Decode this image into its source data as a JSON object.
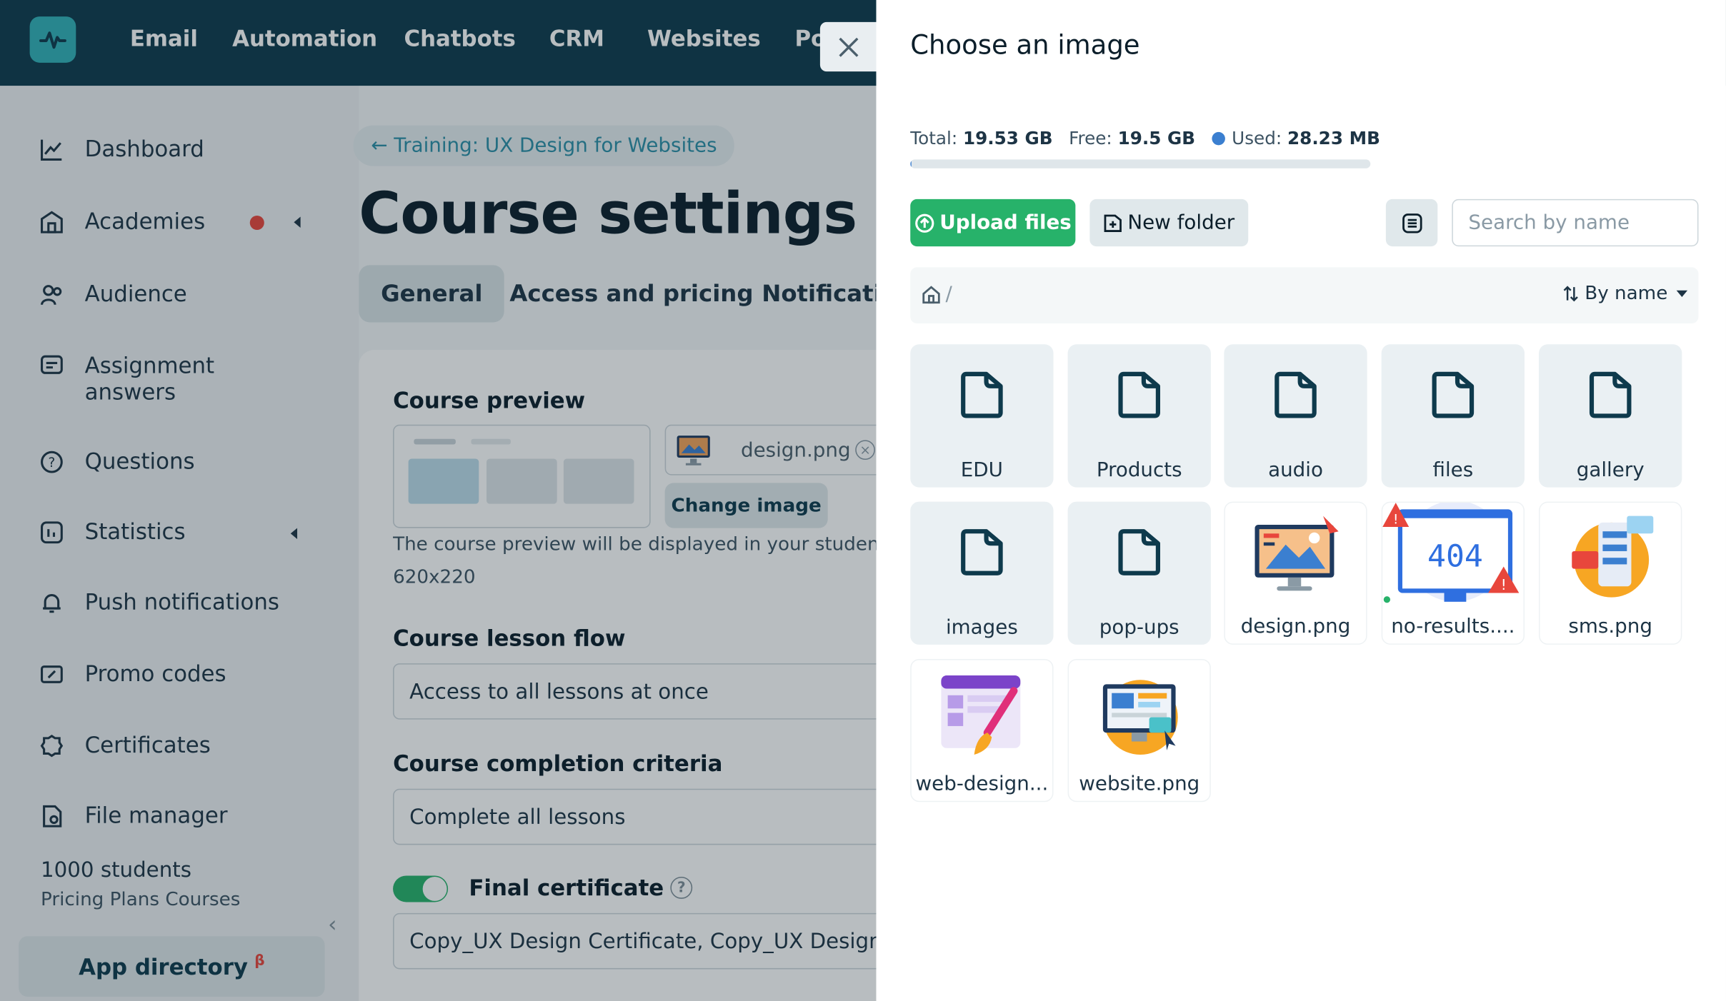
{
  "topnav": {
    "items": [
      "Email",
      "Automation",
      "Chatbots",
      "CRM",
      "Websites",
      "Po"
    ]
  },
  "sidebar": {
    "items": [
      {
        "label": "Dashboard"
      },
      {
        "label": "Academies"
      },
      {
        "label": "Audience"
      },
      {
        "label": "Assignment",
        "label2": "answers"
      },
      {
        "label": "Questions"
      },
      {
        "label": "Statistics"
      },
      {
        "label": "Push notifications"
      },
      {
        "label": "Promo codes"
      },
      {
        "label": "Certificates"
      },
      {
        "label": "File manager"
      }
    ],
    "students": "1000 students",
    "plans": "Pricing Plans Courses",
    "app_directory": "App directory",
    "beta": "β",
    "collapse_icon": "chevron-left-icon"
  },
  "main": {
    "breadcrumb": "← Training: UX Design for Websites",
    "title": "Course settings",
    "tabs": [
      "General",
      "Access and pricing",
      "Notifications"
    ],
    "course_preview": {
      "title": "Course preview",
      "filename": "design.png",
      "change_image": "Change image",
      "hint": "The course preview will be displayed in your students' accounts",
      "size": "620x220"
    },
    "lesson_flow": {
      "title": "Course lesson flow",
      "value": "Access to all lessons at once"
    },
    "completion": {
      "title": "Course completion criteria",
      "value": "Complete all lessons"
    },
    "certificate": {
      "title": "Final certificate",
      "value": "Copy_UX Design Certificate, Copy_UX Design Certificate",
      "enabled": true
    }
  },
  "panel": {
    "title": "Choose an image",
    "storage": {
      "total_label": "Total:",
      "total": "19.53 GB",
      "free_label": "Free:",
      "free": "19.5 GB",
      "used_label": "Used:",
      "used": "28.23 MB",
      "used_fraction": 0.0014,
      "used_color": "#3b7fd0"
    },
    "upload_label": "Upload files",
    "new_folder_label": "New folder",
    "search_placeholder": "Search by name",
    "path": "/",
    "sort_label": "By name",
    "items": [
      {
        "name": "EDU",
        "type": "folder"
      },
      {
        "name": "Products",
        "type": "folder"
      },
      {
        "name": "audio",
        "type": "folder"
      },
      {
        "name": "files",
        "type": "folder"
      },
      {
        "name": "gallery",
        "type": "folder"
      },
      {
        "name": "images",
        "type": "folder"
      },
      {
        "name": "pop-ups",
        "type": "folder"
      },
      {
        "name": "design.png",
        "type": "image",
        "icon": "design-thumbnail-icon"
      },
      {
        "name": "no-results....",
        "type": "image",
        "icon": "404-thumbnail-icon"
      },
      {
        "name": "sms.png",
        "type": "image",
        "icon": "sms-thumbnail-icon"
      },
      {
        "name": "web-design...",
        "type": "image",
        "icon": "web-design-thumbnail-icon"
      },
      {
        "name": "website.png",
        "type": "image",
        "icon": "website-thumbnail-icon"
      }
    ]
  },
  "colors": {
    "topbar": "#0e3a4c",
    "accent_green": "#27b26a",
    "logo": "#31b0b8",
    "link": "#2b8fa6",
    "badge_red": "#e8463c"
  }
}
